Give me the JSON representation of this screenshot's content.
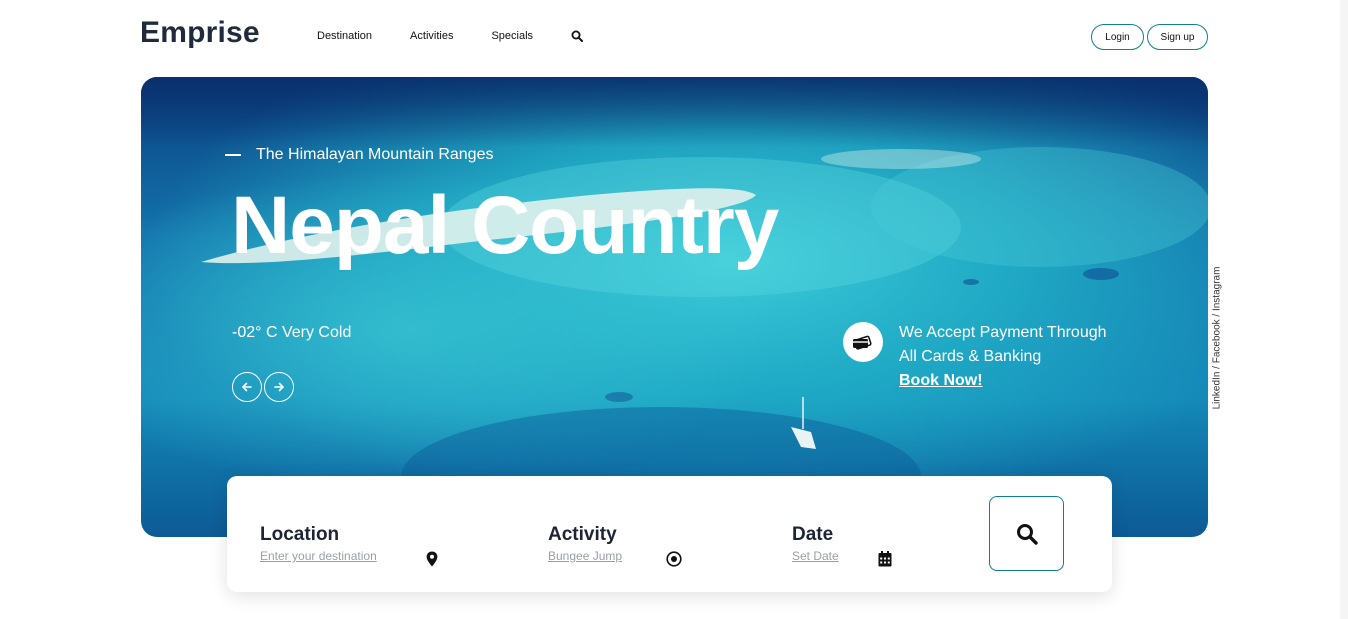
{
  "header": {
    "logo": "Emprise",
    "nav": [
      {
        "label": "Destination"
      },
      {
        "label": "Activities"
      },
      {
        "label": "Specials"
      }
    ],
    "search_icon": "search-icon",
    "login_label": "Login",
    "signup_label": "Sign up"
  },
  "hero": {
    "eyebrow": "The Himalayan Mountain Ranges",
    "title": "Nepal Country",
    "weather": "-02° C Very Cold",
    "prev_icon": "arrow-left-icon",
    "next_icon": "arrow-right-icon",
    "payment_icon": "credit-card-icon",
    "payment_line1": "We Accept Payment Through",
    "payment_line2": "All Cards & Banking",
    "book_now": "Book Now!"
  },
  "social": "LinkedIn / Facebook / Instagram",
  "search_panel": {
    "location": {
      "label": "Location",
      "value": "Enter your destination",
      "icon": "map-pin-icon"
    },
    "activity": {
      "label": "Activity",
      "value": "Bungee Jump",
      "icon": "target-icon"
    },
    "date": {
      "label": "Date",
      "value": "Set Date",
      "icon": "calendar-icon"
    },
    "submit_icon": "search-icon"
  },
  "colors": {
    "accent": "#11808d",
    "ocean_deep": "#0d4f8f",
    "ocean_light": "#22b4c8",
    "text_dark": "#1d2433"
  }
}
